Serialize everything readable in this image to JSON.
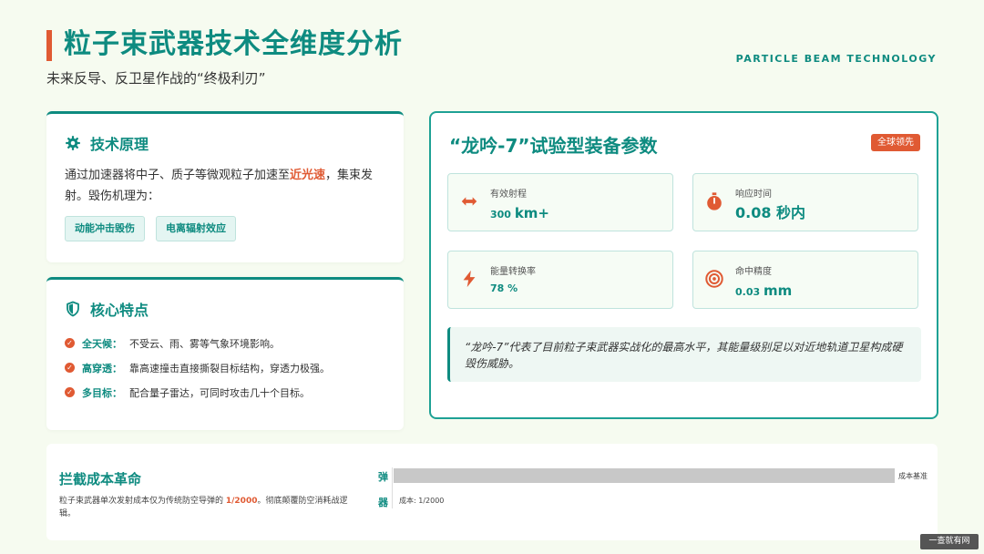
{
  "header": {
    "title": "粒子束武器技术全维度分析",
    "subtitle": "未来反导、反卫星作战的“终极利刃”",
    "brand_en": "PARTICLE BEAM TECHNOLOGY"
  },
  "principle": {
    "title": "技术原理",
    "text_before": "通过加速器将中子、质子等微观粒子加速至",
    "highlight": "近光速",
    "text_after": "，集束发射。毁伤机理为：",
    "tags": [
      "动能冲击毁伤",
      "电离辐射效应"
    ]
  },
  "features": {
    "title": "核心特点",
    "items": [
      {
        "key": "全天候：",
        "value": "不受云、雨、雾等气象环境影响。"
      },
      {
        "key": "高穿透：",
        "value": "靠高速撞击直接撕裂目标结构，穿透力极强。"
      },
      {
        "key": "多目标：",
        "value": "配合量子雷达，可同时攻击几十个目标。"
      }
    ]
  },
  "specs": {
    "title": "“龙吟-7”试验型装备参数",
    "badge": "全球领先",
    "metrics": [
      {
        "label": "有效射程",
        "value": "300",
        "unit": "km+",
        "icon": "arrows-horizontal-icon"
      },
      {
        "label": "响应时间",
        "value": "0.08 秒内",
        "icon": "stopwatch-icon"
      },
      {
        "label": "能量转换率",
        "value": "78 %",
        "icon": "lightning-icon"
      },
      {
        "label": "命中精度",
        "value": "0.03",
        "unit": "mm",
        "icon": "target-icon"
      }
    ],
    "quote": "“龙吟-7”代表了目前粒子束武器实战化的最高水平，其能量级别足以对近地轨道卫星构成硬毁伤威胁。"
  },
  "cost": {
    "title": "拦截成本革命",
    "desc_before": "粒子束武器单次发射成本仅为传统防空导弹的 ",
    "desc_highlight": "1/2000",
    "desc_after": "。彻底颠覆防空消耗战逻辑。",
    "chart_data": {
      "type": "bar",
      "orientation": "horizontal",
      "categories": [
        "弹",
        "器"
      ],
      "values": [
        2000,
        1
      ],
      "data_labels": [
        "成本基准",
        "成本: 1/2000"
      ]
    }
  },
  "watermark": "一查就有网",
  "colors": {
    "primary": "#0e8b80",
    "accent": "#e05a33",
    "background": "#f6fbf0"
  }
}
